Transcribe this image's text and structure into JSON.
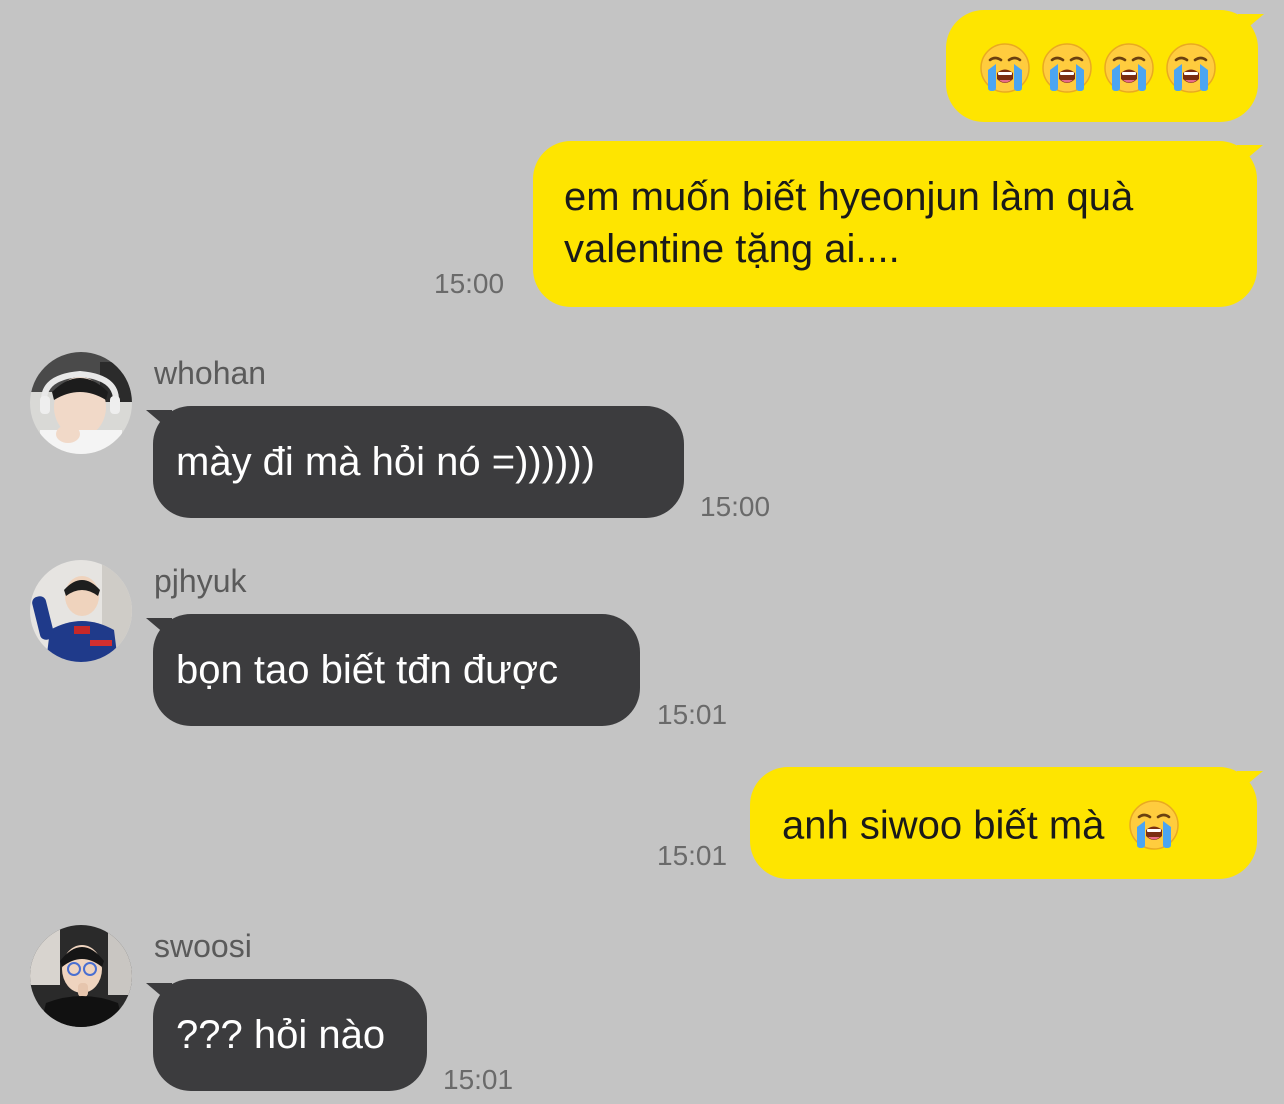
{
  "conversation": {
    "messages": [
      {
        "sender": "me",
        "time": "",
        "emoji": [
          "loudly-crying-face",
          "loudly-crying-face",
          "loudly-crying-face",
          "loudly-crying-face"
        ]
      },
      {
        "sender": "me",
        "time": "15:00",
        "lines": [
          "em muốn biết hyeonjun làm quà",
          "valentine tặng ai...."
        ]
      },
      {
        "sender": "whohan",
        "time": "15:00",
        "text": "mày đi mà hỏi nó =))))))"
      },
      {
        "sender": "pjhyuk",
        "time": "15:01",
        "text": "bọn tao biết tđn được"
      },
      {
        "sender": "me",
        "time": "15:01",
        "text": "anh siwoo biết mà",
        "emoji": [
          "loudly-crying-face"
        ]
      },
      {
        "sender": "swoosi",
        "time": "15:01",
        "text": "??? hỏi nào"
      }
    ]
  },
  "colors": {
    "background": "#c4c4c4",
    "outgoing_bubble": "#fee500",
    "incoming_bubble": "#3c3c3e"
  }
}
